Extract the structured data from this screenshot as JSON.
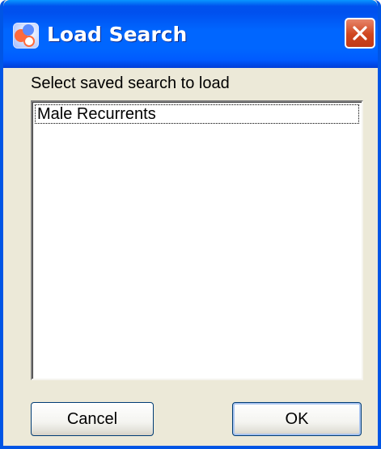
{
  "window": {
    "title": "Load Search",
    "title_icon": "app-icon",
    "close_icon": "close-icon"
  },
  "dialog": {
    "prompt": "Select saved search to load",
    "saved_searches": [
      {
        "label": "Male Recurrents",
        "selected": true
      }
    ]
  },
  "buttons": {
    "cancel_label": "Cancel",
    "ok_label": "OK"
  },
  "colors": {
    "titlebar": "#0058ee",
    "close_button": "#d0461f",
    "dialog_background": "#ece9d8"
  }
}
